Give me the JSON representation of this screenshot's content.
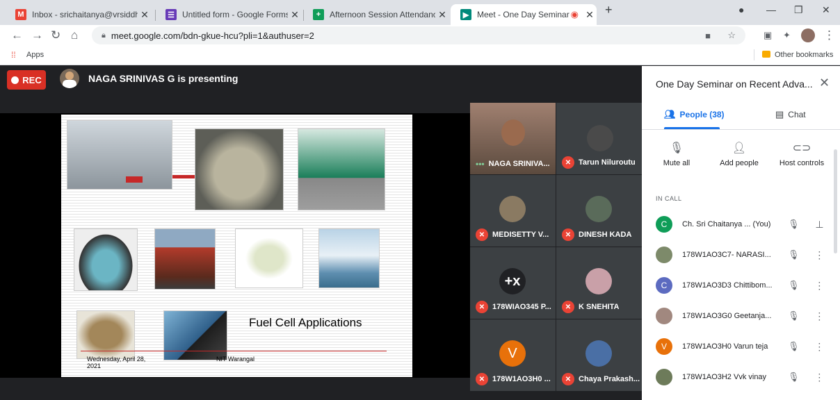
{
  "browser": {
    "tabs": [
      {
        "title": "Inbox - srichaitanya@vrsiddharth",
        "fav_color": "#ea4335",
        "fav_glyph": "M"
      },
      {
        "title": "Untitled form - Google Forms",
        "fav_color": "#673ab7",
        "fav_glyph": "☰"
      },
      {
        "title": "Afternoon Session Attendance -",
        "fav_color": "#0f9d58",
        "fav_glyph": "+"
      },
      {
        "title": "Meet - One Day Seminar on",
        "fav_color": "#00897b",
        "fav_glyph": "▶"
      }
    ],
    "url": "meet.google.com/bdn-gkue-hcu?pli=1&authuser=2",
    "bookmark_apps": "Apps",
    "bookmark_other": "Other bookmarks"
  },
  "meet": {
    "rec_label": "REC",
    "presenting_text": "NAGA SRINIVAS G is presenting",
    "slide": {
      "title": "Fuel Cell Applications",
      "date": "Wednesday, April 28, 2021",
      "footer": "NIT Warangal"
    },
    "tiles": [
      {
        "name": "NAGA SRINIVA...",
        "avatar": "",
        "color": "#6b4f3f",
        "muted": false
      },
      {
        "name": "Tarun Niluroutu",
        "avatar": "",
        "color": "#4a4a4a",
        "muted": true
      },
      {
        "name": "MEDISETTY V...",
        "avatar": "",
        "color": "#8a7a62",
        "muted": true
      },
      {
        "name": "DINESH KADA",
        "avatar": "",
        "color": "#5a6b5a",
        "muted": true
      },
      {
        "name": "178WIAO345 P...",
        "avatar": "+x",
        "color": "#202124",
        "muted": true
      },
      {
        "name": "K SNEHITA",
        "avatar": "",
        "color": "#c9a0a8",
        "muted": true
      },
      {
        "name": "178W1AO3H0 ...",
        "avatar": "V",
        "color": "#e8710a",
        "muted": true
      },
      {
        "name": "Chaya Prakash...",
        "avatar": "",
        "color": "#4a6fa5",
        "muted": true
      }
    ]
  },
  "panel": {
    "title": "One Day Seminar on Recent Adva...",
    "tab_people": "People (38)",
    "tab_chat": "Chat",
    "actions": [
      "Mute all",
      "Add people",
      "Host controls"
    ],
    "section": "IN CALL",
    "participants": [
      {
        "name": "Ch. Sri Chaitanya ...",
        "suffix": "(You)",
        "avatar": "C",
        "color": "#0f9d58",
        "end": "pin"
      },
      {
        "name": "178W1AO3C7- NARASI...",
        "suffix": "",
        "avatar": "",
        "color": "#7d8a6a",
        "end": "more"
      },
      {
        "name": "178W1AO3D3 Chittibom...",
        "suffix": "",
        "avatar": "C",
        "color": "#5c6bc0",
        "end": "more"
      },
      {
        "name": "178W1AO3G0 Geetanja...",
        "suffix": "",
        "avatar": "",
        "color": "#a1887f",
        "end": "more"
      },
      {
        "name": "178W1AO3H0 Varun teja",
        "suffix": "",
        "avatar": "V",
        "color": "#e8710a",
        "end": "more"
      },
      {
        "name": "178W1AO3H2 Vvk vinay",
        "suffix": "",
        "avatar": "",
        "color": "#6d7b5a",
        "end": "more"
      }
    ]
  }
}
